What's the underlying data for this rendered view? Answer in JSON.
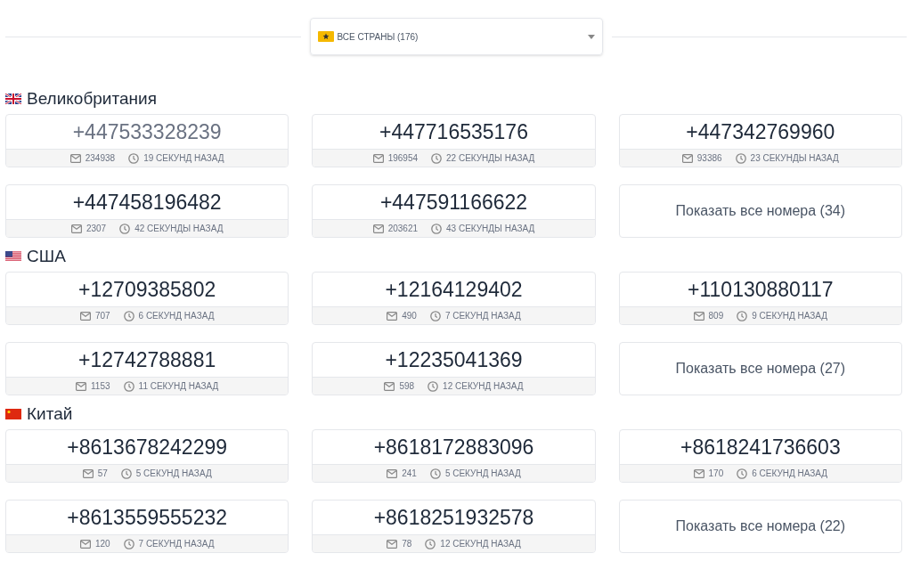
{
  "country_select": {
    "label": "ВСЕ СТРАНЫ (176)"
  },
  "sections": [
    {
      "country": "Великобритания",
      "kind": "gb",
      "numbers": [
        {
          "number": "+447533328239",
          "messages": "234938",
          "time": "19 СЕКУНД НАЗАД",
          "visited": true
        },
        {
          "number": "+447716535176",
          "messages": "196954",
          "time": "22 СЕКУНДЫ НАЗАД",
          "visited": false
        },
        {
          "number": "+447342769960",
          "messages": "93386",
          "time": "23 СЕКУНДЫ НАЗАД",
          "visited": false
        },
        {
          "number": "+447458196482",
          "messages": "2307",
          "time": "42 СЕКУНДЫ НАЗАД",
          "visited": false
        },
        {
          "number": "+447591166622",
          "messages": "203621",
          "time": "43 СЕКУНДЫ НАЗАД",
          "visited": false
        }
      ],
      "show_all": "Показать все номера (34)"
    },
    {
      "country": "США",
      "kind": "us",
      "numbers": [
        {
          "number": "+12709385802",
          "messages": "707",
          "time": "6 СЕКУНД НАЗАД",
          "visited": false
        },
        {
          "number": "+12164129402",
          "messages": "490",
          "time": "7 СЕКУНД НАЗАД",
          "visited": false
        },
        {
          "number": "+110130880117",
          "messages": "809",
          "time": "9 СЕКУНД НАЗАД",
          "visited": false
        },
        {
          "number": "+12742788881",
          "messages": "1153",
          "time": "11 СЕКУНД НАЗАД",
          "visited": false
        },
        {
          "number": "+12235041369",
          "messages": "598",
          "time": "12 СЕКУНД НАЗАД",
          "visited": false
        }
      ],
      "show_all": "Показать все номера (27)"
    },
    {
      "country": "Китай",
      "kind": "cn",
      "numbers": [
        {
          "number": "+8613678242299",
          "messages": "57",
          "time": "5 СЕКУНД НАЗАД",
          "visited": false
        },
        {
          "number": "+8618172883096",
          "messages": "241",
          "time": "5 СЕКУНД НАЗАД",
          "visited": false
        },
        {
          "number": "+8618241736603",
          "messages": "170",
          "time": "6 СЕКУНД НАЗАД",
          "visited": false
        },
        {
          "number": "+8613559555232",
          "messages": "120",
          "time": "7 СЕКУНД НАЗАД",
          "visited": false
        },
        {
          "number": "+8618251932578",
          "messages": "78",
          "time": "12 СЕКУНД НАЗАД",
          "visited": false
        }
      ],
      "show_all": "Показать все номера (22)"
    }
  ]
}
